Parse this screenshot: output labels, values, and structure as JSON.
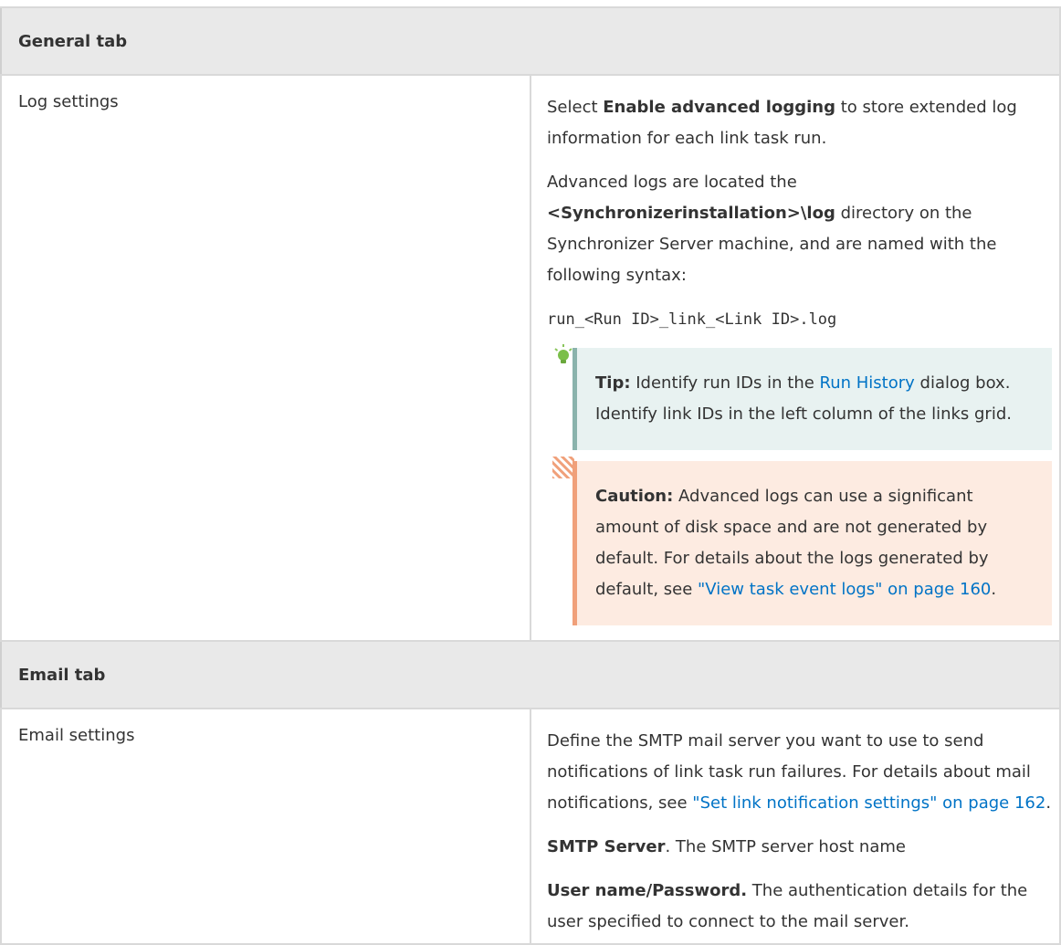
{
  "general": {
    "header": "General tab",
    "log_label": "Log settings",
    "p1_a": "Select ",
    "p1_b": "Enable advanced logging",
    "p1_c": " to store extended log information for each link task run.",
    "p2_a": "Advanced logs are located the ",
    "p2_b": "<Synchronizerinstallation>\\log",
    "p2_c": " directory on the Synchronizer Server machine, and are named with the following syntax:",
    "syntax": "run_<Run ID>_link_<Link ID>.log",
    "tip": {
      "label": "Tip:",
      "text_a": " Identify run IDs in the ",
      "link": "Run History",
      "text_b": " dialog box. Identify link IDs in the left column of the links grid.",
      "icon": "lightbulb-icon"
    },
    "caution": {
      "label": "Caution:",
      "text_a": " Advanced logs can use a significant amount of disk space and are not generated by default. For details about the logs generated by default, see ",
      "link": "\"View task event logs\" on page 160",
      "text_b": ".",
      "icon": "hatched-caution-icon"
    }
  },
  "email": {
    "header": "Email tab",
    "label": "Email settings",
    "p1_a": "Define the SMTP mail server you want to use to send notifications of link task run failures. For details about mail notifications, see ",
    "p1_link": "\"Set link notification settings\" on page 162",
    "p1_b": ".",
    "smtp_bold": "SMTP Server",
    "smtp_text": ". The SMTP server host name",
    "user_bold": "User name/Password.",
    "user_text": " The authentication details for the user specified to connect to the mail server."
  },
  "colors": {
    "link": "#0073c6",
    "tip_bg": "#e8f2f1",
    "tip_border": "#8ab3ac",
    "caution_bg": "#fdebe1",
    "caution_border": "#f0a07a",
    "header_bg": "#e9e9e9"
  }
}
